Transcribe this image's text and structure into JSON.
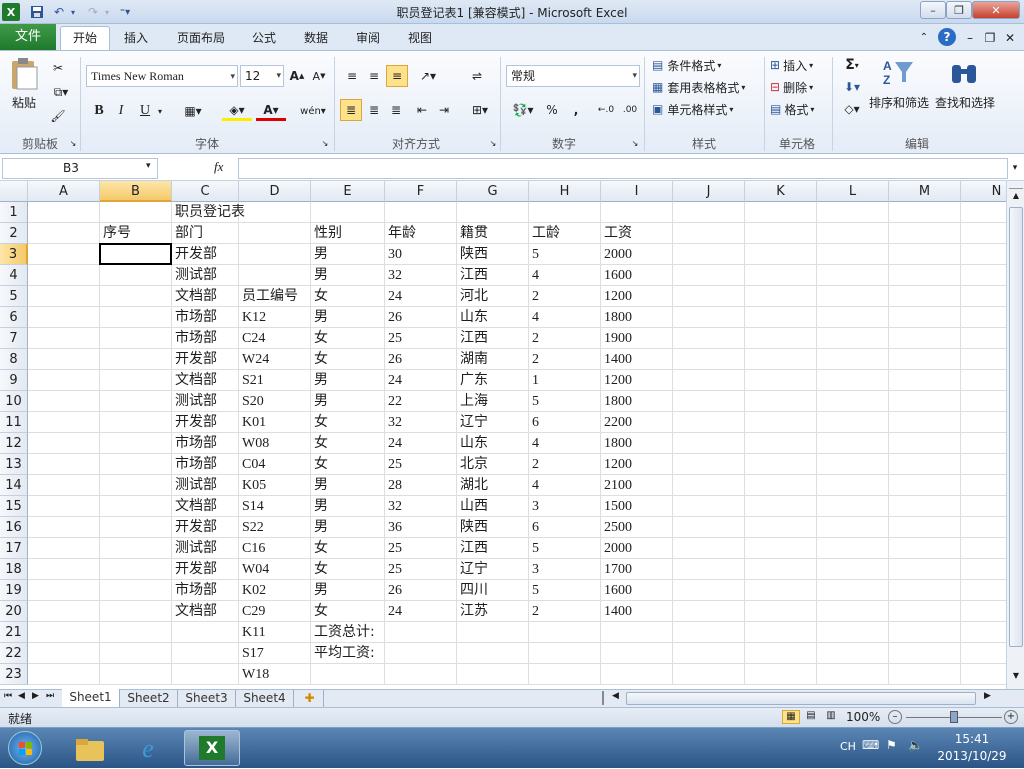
{
  "window": {
    "title": "职员登记表1  [兼容模式]  -  Microsoft Excel"
  },
  "qat": {
    "app_icon": "excel-icon",
    "save": "save-icon",
    "undo": "undo-icon",
    "redo": "redo-icon"
  },
  "tabs": [
    {
      "label": "文件"
    },
    {
      "label": "开始"
    },
    {
      "label": "插入"
    },
    {
      "label": "页面布局"
    },
    {
      "label": "公式"
    },
    {
      "label": "数据"
    },
    {
      "label": "审阅"
    },
    {
      "label": "视图"
    }
  ],
  "ribbon": {
    "clipboard": {
      "paste": "粘贴",
      "label": "剪贴板"
    },
    "font": {
      "family": "Times New Roman",
      "size": "12",
      "bold": "B",
      "italic": "I",
      "underline": "U",
      "label": "字体"
    },
    "align": {
      "label": "对齐方式"
    },
    "number": {
      "format": "常规",
      "percent": "%",
      "comma": ",",
      "label": "数字"
    },
    "styles": {
      "conditional": "条件格式",
      "table": "套用表格格式",
      "cell": "单元格样式",
      "label": "样式"
    },
    "cells": {
      "insert": "插入",
      "delete": "删除",
      "format": "格式",
      "label": "单元格"
    },
    "editing": {
      "sum": "Σ",
      "sort": "排序和筛选",
      "find": "查找和选择",
      "label": "编辑"
    }
  },
  "formula_bar": {
    "name_box": "B3",
    "fx": "fx",
    "value": ""
  },
  "columns": [
    "A",
    "B",
    "C",
    "D",
    "E",
    "F",
    "G",
    "H",
    "I",
    "J",
    "K",
    "L",
    "M",
    "N"
  ],
  "rows": [
    "1",
    "2",
    "3",
    "4",
    "5",
    "6",
    "7",
    "8",
    "9",
    "10",
    "11",
    "12",
    "13",
    "14",
    "15",
    "16",
    "17",
    "18",
    "19",
    "20",
    "21",
    "22",
    "23"
  ],
  "sheet": {
    "title": "职员登记表",
    "headers": {
      "b": "序号",
      "c": "部门",
      "e": "性别",
      "f": "年龄",
      "g": "籍贯",
      "h": "工龄",
      "i": "工资"
    },
    "data": [
      {
        "c": "开发部",
        "d": "",
        "e": "男",
        "f": "30",
        "g": "陕西",
        "h": "5",
        "i": "2000"
      },
      {
        "c": "测试部",
        "d": "",
        "e": "男",
        "f": "32",
        "g": "江西",
        "h": "4",
        "i": "1600"
      },
      {
        "c": "文档部",
        "d": "员工编号",
        "e": "女",
        "f": "24",
        "g": "河北",
        "h": "2",
        "i": "1200"
      },
      {
        "c": "市场部",
        "d": "K12",
        "e": "男",
        "f": "26",
        "g": "山东",
        "h": "4",
        "i": "1800"
      },
      {
        "c": "市场部",
        "d": "C24",
        "e": "女",
        "f": "25",
        "g": "江西",
        "h": "2",
        "i": "1900"
      },
      {
        "c": "开发部",
        "d": "W24",
        "e": "女",
        "f": "26",
        "g": "湖南",
        "h": "2",
        "i": "1400"
      },
      {
        "c": "文档部",
        "d": "S21",
        "e": "男",
        "f": "24",
        "g": "广东",
        "h": "1",
        "i": "1200"
      },
      {
        "c": "测试部",
        "d": "S20",
        "e": "男",
        "f": "22",
        "g": "上海",
        "h": "5",
        "i": "1800"
      },
      {
        "c": "开发部",
        "d": "K01",
        "e": "女",
        "f": "32",
        "g": "辽宁",
        "h": "6",
        "i": "2200"
      },
      {
        "c": "市场部",
        "d": "W08",
        "e": "女",
        "f": "24",
        "g": "山东",
        "h": "4",
        "i": "1800"
      },
      {
        "c": "市场部",
        "d": "C04",
        "e": "女",
        "f": "25",
        "g": "北京",
        "h": "2",
        "i": "1200"
      },
      {
        "c": "测试部",
        "d": "K05",
        "e": "男",
        "f": "28",
        "g": "湖北",
        "h": "4",
        "i": "2100"
      },
      {
        "c": "文档部",
        "d": "S14",
        "e": "男",
        "f": "32",
        "g": "山西",
        "h": "3",
        "i": "1500"
      },
      {
        "c": "开发部",
        "d": "S22",
        "e": "男",
        "f": "36",
        "g": "陕西",
        "h": "6",
        "i": "2500"
      },
      {
        "c": "测试部",
        "d": "C16",
        "e": "女",
        "f": "25",
        "g": "江西",
        "h": "5",
        "i": "2000"
      },
      {
        "c": "开发部",
        "d": "W04",
        "e": "女",
        "f": "25",
        "g": "辽宁",
        "h": "3",
        "i": "1700"
      },
      {
        "c": "市场部",
        "d": "K02",
        "e": "男",
        "f": "26",
        "g": "四川",
        "h": "5",
        "i": "1600"
      },
      {
        "c": "文档部",
        "d": "C29",
        "e": "女",
        "f": "24",
        "g": "江苏",
        "h": "2",
        "i": "1400"
      }
    ],
    "extra_d": [
      "K11",
      "S17",
      "W18"
    ],
    "total_label": "工资总计:",
    "avg_label": "平均工资:"
  },
  "sheets": [
    "Sheet1",
    "Sheet2",
    "Sheet3",
    "Sheet4"
  ],
  "status": {
    "ready": "就绪",
    "zoom": "100%"
  },
  "taskbar": {
    "lang": "CH",
    "time": "15:41",
    "date": "2013/10/29"
  }
}
